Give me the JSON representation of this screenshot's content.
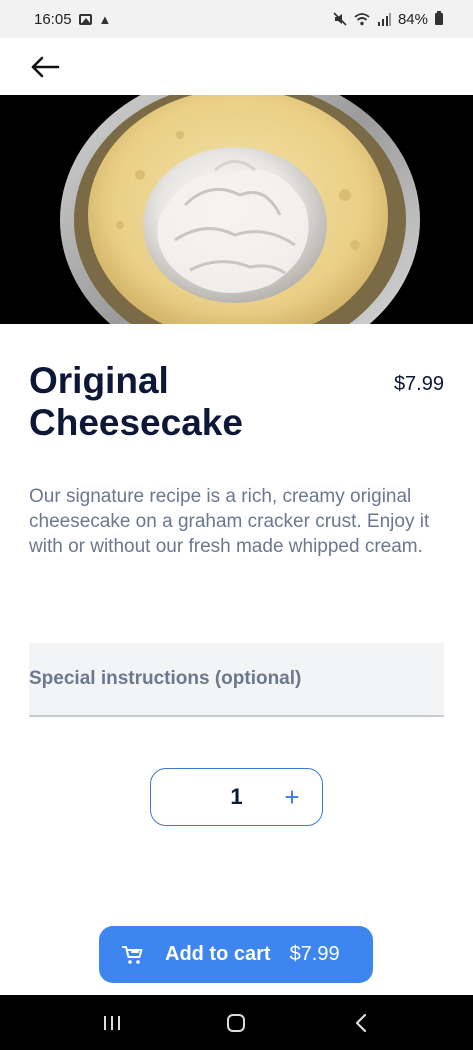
{
  "status_bar": {
    "time": "16:05",
    "battery": "84%",
    "icons": [
      "gallery-icon",
      "drive-icon",
      "mute-icon",
      "wifi-icon",
      "signal-icon",
      "battery-icon"
    ]
  },
  "app_bar": {
    "back_icon": "arrow-left-icon"
  },
  "product": {
    "name": "Original Cheesecake",
    "price": "$7.99",
    "description": "Our signature recipe is a rich, creamy original cheesecake on a graham cracker crust. Enjoy it with or without our fresh made whipped cream.",
    "image": "cheesecake-photo"
  },
  "instructions": {
    "placeholder": "Special instructions (optional)",
    "value": ""
  },
  "quantity": {
    "value": "1",
    "increment_label": "+"
  },
  "cart_button": {
    "label": "Add to cart",
    "price": "$7.99",
    "icon": "cart-icon"
  },
  "colors": {
    "accent": "#3d85ef",
    "title": "#0d1838",
    "muted_text": "#6b7890"
  }
}
